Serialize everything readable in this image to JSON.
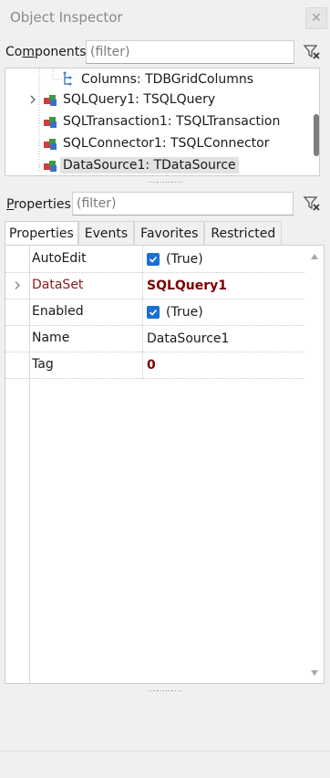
{
  "window": {
    "title": "Object Inspector",
    "close_glyph": "✕"
  },
  "components": {
    "label_pre": "Co",
    "label_mnemonic": "m",
    "label_post": "ponents",
    "filter_placeholder": "(filter)",
    "tree": [
      {
        "label": "Columns: TDBGridColumns",
        "icon": "collection-icon",
        "expander": false
      },
      {
        "label": "SQLQuery1: TSQLQuery",
        "icon": "component-icon",
        "expander": true
      },
      {
        "label": "SQLTransaction1: TSQLTransaction",
        "icon": "component-icon",
        "expander": false
      },
      {
        "label": "SQLConnector1: TSQLConnector",
        "icon": "component-icon",
        "expander": false
      },
      {
        "label": "DataSource1: TDataSource",
        "icon": "component-icon",
        "expander": false,
        "selected": true
      }
    ]
  },
  "properties": {
    "label_mnemonic": "P",
    "label_post": "roperties",
    "filter_placeholder": "(filter)",
    "tabs": [
      {
        "label": "Properties",
        "active": true
      },
      {
        "label": "Events"
      },
      {
        "label": "Favorites"
      },
      {
        "label": "Restricted"
      }
    ],
    "rows": [
      {
        "name": "AutoEdit",
        "value": "(True)",
        "checkbox": true,
        "checked": true
      },
      {
        "name": "DataSet",
        "value": "SQLQuery1",
        "expander": true,
        "style": "reference"
      },
      {
        "name": "Enabled",
        "value": "(True)",
        "checkbox": true,
        "checked": true
      },
      {
        "name": "Name",
        "value": "DataSource1"
      },
      {
        "name": "Tag",
        "value": "0",
        "style": "number"
      }
    ]
  },
  "colors": {
    "checkbox": "#1a6fd1",
    "reference_value": "#7b0000",
    "reference_name": "#8b1a1a"
  }
}
